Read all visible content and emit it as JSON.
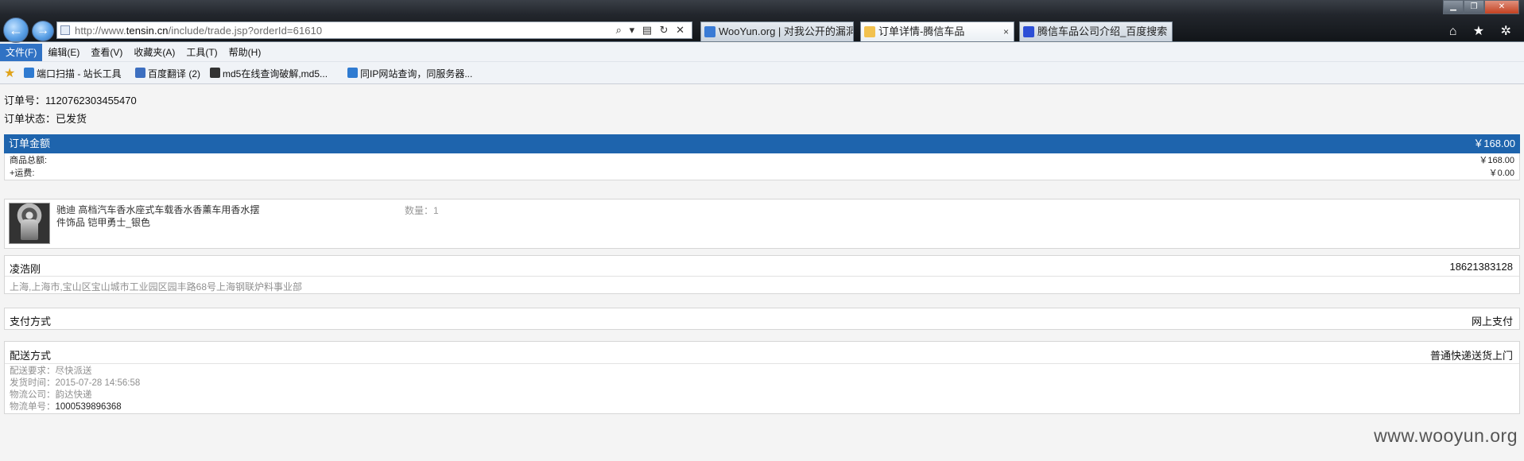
{
  "browser": {
    "url_prefix": "http://www.",
    "url_domain": "tensin.cn",
    "url_path": "/include/trade.jsp?orderId=61610",
    "tabs": [
      {
        "label": "WooYun.org | 对我公开的漏洞",
        "active": false
      },
      {
        "label": "订单详情-腾信车品",
        "active": true
      },
      {
        "label": "腾信车品公司介绍_百度搜索",
        "active": false
      }
    ],
    "tab_close": "×",
    "addr_tools": "⌕ ▾ ▤ ↻ ✕",
    "back": "←",
    "forward": "→",
    "right_icons": "⌂ ★ ✲",
    "win": {
      "min": "▁",
      "max": "❐",
      "close": "✕"
    }
  },
  "menu": [
    "文件(F)",
    "编辑(E)",
    "查看(V)",
    "收藏夹(A)",
    "工具(T)",
    "帮助(H)"
  ],
  "favorites": [
    {
      "label": "端口扫描 - 站长工具",
      "color": "#2f7bd1"
    },
    {
      "label": "百度翻译 (2)",
      "color": "#3d6fc0"
    },
    {
      "label": "md5在线查询破解,md5...",
      "color": "#333333"
    },
    {
      "label": "同IP网站查询，同服务器...",
      "color": "#2f7bd1"
    }
  ],
  "order": {
    "number_label": "订单号：",
    "number": "1120762303455470",
    "status_label": "订单状态：",
    "status": "已发货"
  },
  "amount": {
    "label": "订单金额",
    "total": "￥168.00",
    "goods_label": "商品总额:",
    "goods_value": "￥168.00",
    "shipping_label": "+运费:",
    "shipping_value": "￥0.00"
  },
  "product": {
    "name": "驰迪 高档汽车香水座式车载香水香薰车用香水摆件饰品 铠甲勇士_银色",
    "qty": "数量：1"
  },
  "recipient": {
    "name": "凌浩刚",
    "phone": "18621383128",
    "address": "上海,上海市,宝山区宝山城市工业园区园丰路68号上海钢联炉料事业部"
  },
  "payment": {
    "label": "支付方式",
    "value": "网上支付"
  },
  "delivery": {
    "label": "配送方式",
    "value": "普通快递送货上门",
    "req_label": "配送要求：",
    "req_value": "尽快派送",
    "time_label": "发货时间：",
    "time_value": "2015-07-28 14:56:58",
    "company_label": "物流公司：",
    "company_value": "韵达快递",
    "tracking_label": "物流单号：",
    "tracking_value": "1000539896368"
  },
  "watermark": "www.wooyun.org",
  "colors": {
    "accent": "#1e64ad",
    "menu_active": "#3072c4"
  }
}
